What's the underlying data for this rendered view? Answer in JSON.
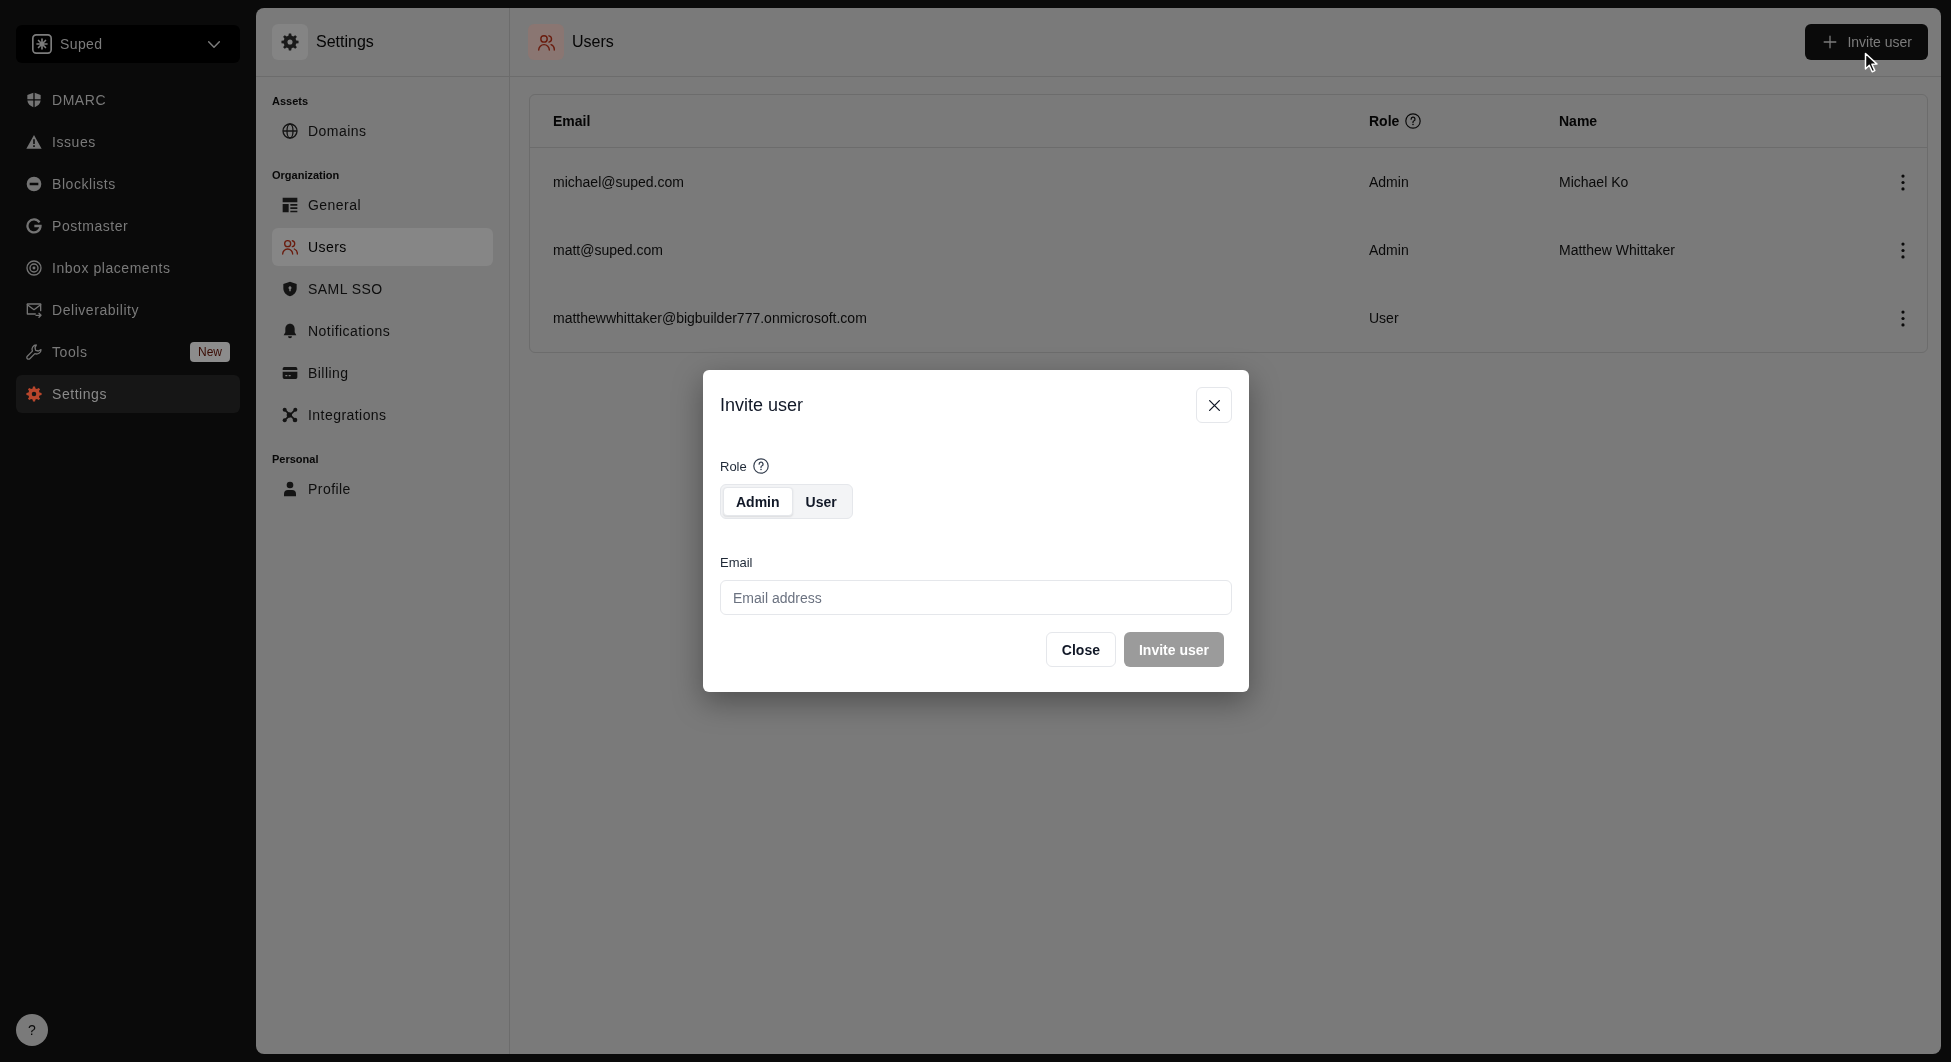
{
  "sidebar": {
    "workspace": {
      "name": "Suped"
    },
    "items": [
      {
        "label": "DMARC",
        "selected": false
      },
      {
        "label": "Issues",
        "selected": false
      },
      {
        "label": "Blocklists",
        "selected": false
      },
      {
        "label": "Postmaster",
        "selected": false
      },
      {
        "label": "Inbox placements",
        "selected": false
      },
      {
        "label": "Deliverability",
        "selected": false
      },
      {
        "label": "Tools",
        "badge": "New",
        "selected": false
      },
      {
        "label": "Settings",
        "selected": true
      }
    ],
    "help_button": {
      "label": "?"
    }
  },
  "settings_nav": {
    "title": "Settings",
    "sections": [
      {
        "heading": "Assets",
        "items": [
          {
            "label": "Domains",
            "selected": false
          }
        ]
      },
      {
        "heading": "Organization",
        "items": [
          {
            "label": "General",
            "selected": false
          },
          {
            "label": "Users",
            "selected": true
          },
          {
            "label": "SAML SSO",
            "selected": false
          },
          {
            "label": "Notifications",
            "selected": false
          },
          {
            "label": "Billing",
            "selected": false
          },
          {
            "label": "Integrations",
            "selected": false
          }
        ]
      },
      {
        "heading": "Personal",
        "items": [
          {
            "label": "Profile",
            "selected": false
          }
        ]
      }
    ]
  },
  "page": {
    "title": "Users",
    "invite_button": {
      "label": "Invite user"
    }
  },
  "table": {
    "columns": [
      {
        "label": "Email"
      },
      {
        "label": "Role",
        "help": true
      },
      {
        "label": "Name"
      }
    ],
    "rows": [
      {
        "email": "michael@suped.com",
        "role": "Admin",
        "name": "Michael Ko"
      },
      {
        "email": "matt@suped.com",
        "role": "Admin",
        "name": "Matthew Whittaker"
      },
      {
        "email": "matthewwhittaker@bigbuilder777.onmicrosoft.com",
        "role": "User"
      }
    ]
  },
  "dialog": {
    "title": "Invite user",
    "role_field": {
      "label": "Role",
      "help": true,
      "options": [
        {
          "label": "Admin",
          "selected": true
        },
        {
          "label": "User",
          "selected": false
        }
      ]
    },
    "email_field": {
      "label": "Email",
      "placeholder": "Email address"
    },
    "buttons": [
      {
        "label": "Close",
        "kind": "secondary",
        "disabled": false
      },
      {
        "label": "Invite user",
        "kind": "primary",
        "disabled": true
      }
    ]
  }
}
